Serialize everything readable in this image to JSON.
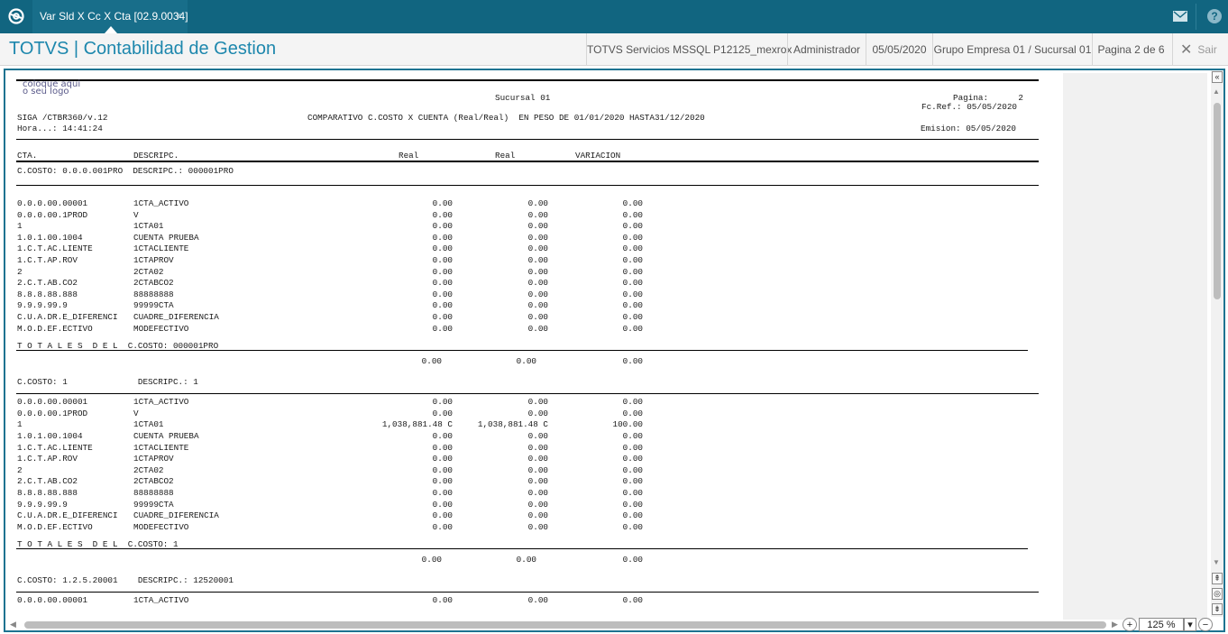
{
  "tab": {
    "title": "Var Sld X Cc X Cta [02.9.0034]",
    "close": "×"
  },
  "header": {
    "app_title": "TOTVS | Contabilidad de Gestion",
    "server": "TOTVS Servicios MSSQL P12125_mexrox",
    "user": "Administrador",
    "date": "05/05/2020",
    "company": "Grupo Empresa 01 / Sucursal 01",
    "page": "Pagina 2 de 6",
    "exit": "Sair"
  },
  "icons": {
    "logo": "totvs-logo-icon",
    "mail": "mail-icon",
    "help": "help-icon",
    "close": "close-icon",
    "collapse": "collapse-icon",
    "zoom_in": "zoom-in-icon",
    "zoom_out": "zoom-out-icon",
    "nav_up": "page-up-icon",
    "nav_circle": "page-first-icon",
    "nav_down": "page-down-icon"
  },
  "colors": {
    "topbar": "#116580",
    "title": "#1d87ad",
    "frame": "#1e7391"
  },
  "report": {
    "stamp": "coloque aqui\no seu logo",
    "branch": "Sucursal 01",
    "page_label": "Pagina:",
    "page_value": "2",
    "ref_label": "Fc.Ref.: 05/05/2020",
    "program": "SIGA /CTBR360/v.12",
    "title": "COMPARATIVO C.COSTO X CUENTA (Real/Real)  EN PESO DE 01/01/2020 HASTA31/12/2020",
    "hour": "Hora...: 14:41:24",
    "emission": "Emision: 05/05/2020",
    "col_cta": "CTA.",
    "col_desc": "DESCRIPC.",
    "col_real1": "Real",
    "col_real2": "Real",
    "col_var": "VARIACION",
    "sections": [
      {
        "header": "C.COSTO: 0.0.0.001PRO  DESCRIPC.: 000001PRO",
        "rows": [
          {
            "cta": "0.0.0.00.00001",
            "desc": "1CTA_ACTIVO",
            "real1": "0.00",
            "real2": "0.00",
            "var": "0.00"
          },
          {
            "cta": "0.0.0.00.1PROD",
            "desc": "V",
            "real1": "0.00",
            "real2": "0.00",
            "var": "0.00"
          },
          {
            "cta": "1",
            "desc": "1CTA01",
            "real1": "0.00",
            "real2": "0.00",
            "var": "0.00"
          },
          {
            "cta": "1.0.1.00.1004",
            "desc": "CUENTA PRUEBA",
            "real1": "0.00",
            "real2": "0.00",
            "var": "0.00"
          },
          {
            "cta": "1.C.T.AC.LIENTE",
            "desc": "1CTACLIENTE",
            "real1": "0.00",
            "real2": "0.00",
            "var": "0.00"
          },
          {
            "cta": "1.C.T.AP.ROV",
            "desc": "1CTAPROV",
            "real1": "0.00",
            "real2": "0.00",
            "var": "0.00"
          },
          {
            "cta": "2",
            "desc": "2CTA02",
            "real1": "0.00",
            "real2": "0.00",
            "var": "0.00"
          },
          {
            "cta": "2.C.T.AB.CO2",
            "desc": "2CTABCO2",
            "real1": "0.00",
            "real2": "0.00",
            "var": "0.00"
          },
          {
            "cta": "8.8.8.88.888",
            "desc": "88888888",
            "real1": "0.00",
            "real2": "0.00",
            "var": "0.00"
          },
          {
            "cta": "9.9.9.99.9",
            "desc": "99999CTA",
            "real1": "0.00",
            "real2": "0.00",
            "var": "0.00"
          },
          {
            "cta": "C.U.A.DR.E_DIFERENCI",
            "desc": "CUADRE_DIFERENCIA",
            "real1": "0.00",
            "real2": "0.00",
            "var": "0.00"
          },
          {
            "cta": "M.O.D.EF.ECTIVO",
            "desc": "MODEFECTIVO",
            "real1": "0.00",
            "real2": "0.00",
            "var": "0.00"
          }
        ],
        "total_label": "T O T A L E S  D E L  C.COSTO: 000001PRO",
        "totals": {
          "real1": "0.00",
          "real2": "0.00",
          "var": "0.00"
        }
      },
      {
        "header": "C.COSTO: 1              DESCRIPC.: 1",
        "rows": [
          {
            "cta": "0.0.0.00.00001",
            "desc": "1CTA_ACTIVO",
            "real1": "0.00",
            "real2": "0.00",
            "var": "0.00"
          },
          {
            "cta": "0.0.0.00.1PROD",
            "desc": "V",
            "real1": "0.00",
            "real2": "0.00",
            "var": "0.00"
          },
          {
            "cta": "1",
            "desc": "1CTA01",
            "real1": "1,038,881.48 C",
            "real2": "1,038,881.48 C",
            "var": "100.00"
          },
          {
            "cta": "1.0.1.00.1004",
            "desc": "CUENTA PRUEBA",
            "real1": "0.00",
            "real2": "0.00",
            "var": "0.00"
          },
          {
            "cta": "1.C.T.AC.LIENTE",
            "desc": "1CTACLIENTE",
            "real1": "0.00",
            "real2": "0.00",
            "var": "0.00"
          },
          {
            "cta": "1.C.T.AP.ROV",
            "desc": "1CTAPROV",
            "real1": "0.00",
            "real2": "0.00",
            "var": "0.00"
          },
          {
            "cta": "2",
            "desc": "2CTA02",
            "real1": "0.00",
            "real2": "0.00",
            "var": "0.00"
          },
          {
            "cta": "2.C.T.AB.CO2",
            "desc": "2CTABCO2",
            "real1": "0.00",
            "real2": "0.00",
            "var": "0.00"
          },
          {
            "cta": "8.8.8.88.888",
            "desc": "88888888",
            "real1": "0.00",
            "real2": "0.00",
            "var": "0.00"
          },
          {
            "cta": "9.9.9.99.9",
            "desc": "99999CTA",
            "real1": "0.00",
            "real2": "0.00",
            "var": "0.00"
          },
          {
            "cta": "C.U.A.DR.E_DIFERENCI",
            "desc": "CUADRE_DIFERENCIA",
            "real1": "0.00",
            "real2": "0.00",
            "var": "0.00"
          },
          {
            "cta": "M.O.D.EF.ECTIVO",
            "desc": "MODEFECTIVO",
            "real1": "0.00",
            "real2": "0.00",
            "var": "0.00"
          }
        ],
        "total_label": "T O T A L E S  D E L  C.COSTO: 1",
        "totals": {
          "real1": "0.00",
          "real2": "0.00",
          "var": "0.00"
        }
      },
      {
        "header": "C.COSTO: 1.2.5.20001    DESCRIPC.: 12520001",
        "rows": [
          {
            "cta": "0.0.0.00.00001",
            "desc": "1CTA_ACTIVO",
            "real1": "0.00",
            "real2": "0.00",
            "var": "0.00"
          }
        ]
      }
    ]
  },
  "zoom": {
    "level": "125 %"
  }
}
